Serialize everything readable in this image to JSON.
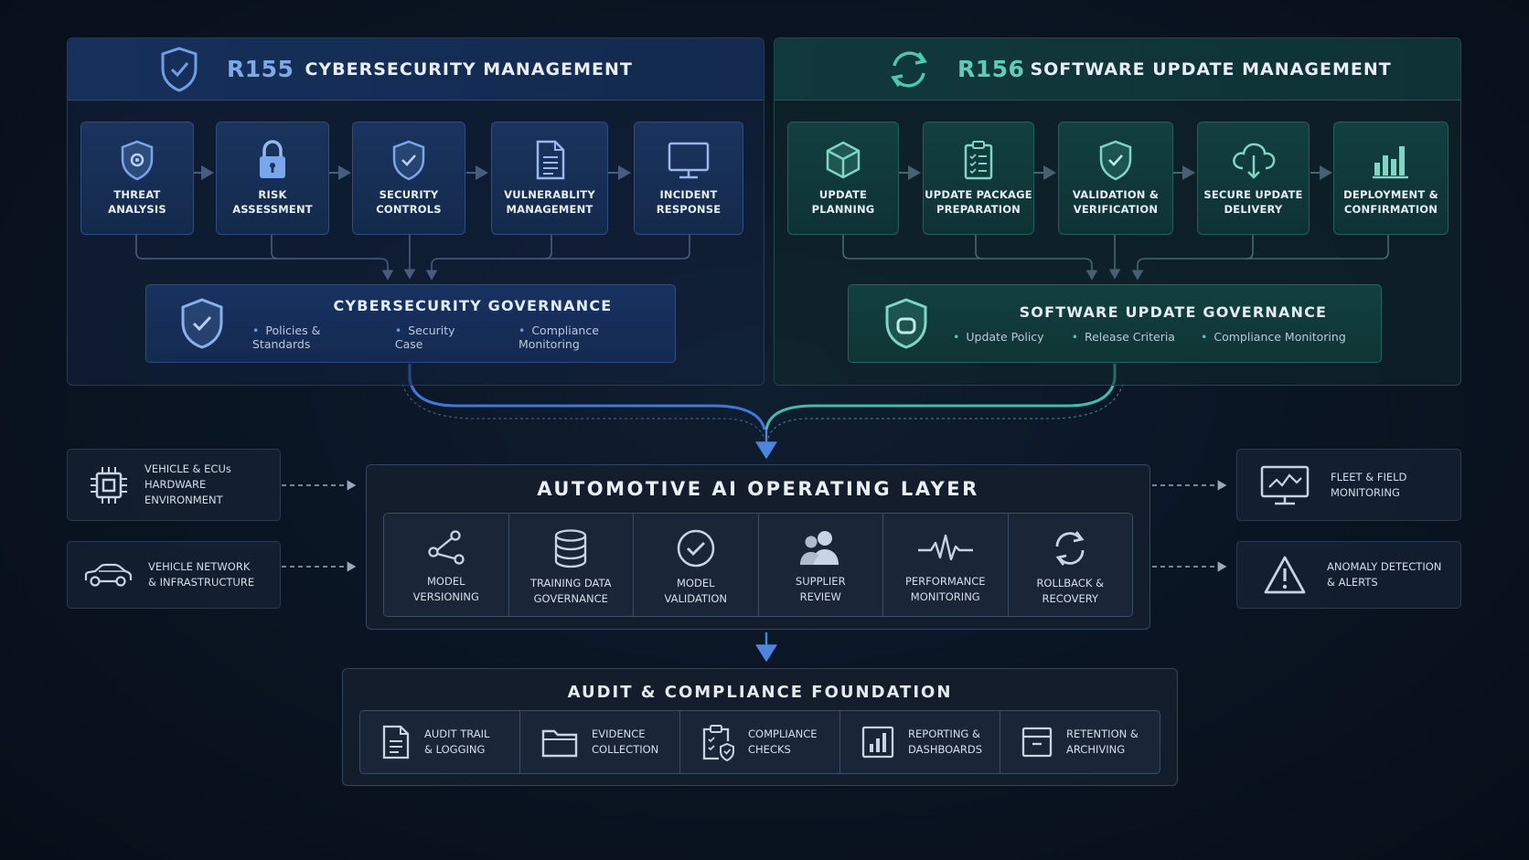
{
  "r155": {
    "code": "R155",
    "title": "CYBERSECURITY MANAGEMENT",
    "steps": [
      {
        "label": "THREAT\nANALYSIS",
        "icon": "shield-target-icon"
      },
      {
        "label": "RISK\nASSESSMENT",
        "icon": "lock-icon"
      },
      {
        "label": "SECURITY\nCONTROLS",
        "icon": "shield-check-icon"
      },
      {
        "label": "VULNERABLITY\nMANAGEMENT",
        "icon": "document-icon"
      },
      {
        "label": "INCIDENT\nRESPONSE",
        "icon": "monitor-icon"
      }
    ],
    "governance": {
      "title": "CYBERSECURITY GOVERNANCE",
      "items": [
        "Policies & Standards",
        "Security Case",
        "Compliance Monitoring"
      ]
    }
  },
  "r156": {
    "code": "R156",
    "title": "SOFTWARE UPDATE MANAGEMENT",
    "steps": [
      {
        "label": "UPDATE\nPLANNING",
        "icon": "cube-icon"
      },
      {
        "label": "UPDATE PACKAGE\nPREPARATION",
        "icon": "clipboard-checklist-icon"
      },
      {
        "label": "VALIDATION &\nVERIFICATION",
        "icon": "shield-check-icon"
      },
      {
        "label": "SECURE UPDATE\nDELIVERY",
        "icon": "cloud-download-icon"
      },
      {
        "label": "DEPLOYMENT &\nCONFIRMATION",
        "icon": "bar-chart-icon"
      }
    ],
    "governance": {
      "title": "SOFTWARE UPDATE GOVERNANCE",
      "items": [
        "Update Policy",
        "Release Criteria",
        "Compliance Monitoring"
      ]
    }
  },
  "inputs": [
    {
      "label": "VEHICLE & ECUs\nHARDWARE ENVIRONMENT",
      "icon": "chip-icon"
    },
    {
      "label": "VEHICLE NETWORK\n& INFRASTRUCTURE",
      "icon": "car-icon"
    }
  ],
  "outputs": [
    {
      "label": "FLEET & FIELD\nMONITORING",
      "icon": "monitor-chart-icon"
    },
    {
      "label": "ANOMALY DETECTION\n& ALERTS",
      "icon": "warning-icon"
    }
  ],
  "ai_layer": {
    "title": "AUTOMOTIVE AI OPERATING LAYER",
    "items": [
      {
        "label": "MODEL\nVERSIONING",
        "icon": "branch-icon"
      },
      {
        "label": "TRAINING DATA\nGOVERNANCE",
        "icon": "database-icon"
      },
      {
        "label": "MODEL\nVALIDATION",
        "icon": "check-circle-icon"
      },
      {
        "label": "SUPPLIER\nREVIEW",
        "icon": "users-icon"
      },
      {
        "label": "PERFORMANCE\nMONITORING",
        "icon": "pulse-icon"
      },
      {
        "label": "ROLLBACK &\nRECOVERY",
        "icon": "refresh-icon"
      }
    ]
  },
  "audit": {
    "title": "AUDIT & COMPLIANCE FOUNDATION",
    "items": [
      {
        "label": "AUDIT TRAIL\n& LOGGING",
        "icon": "document-lines-icon"
      },
      {
        "label": "EVIDENCE\nCOLLECTION",
        "icon": "folder-icon"
      },
      {
        "label": "COMPLIANCE\nCHECKS",
        "icon": "clipboard-shield-icon"
      },
      {
        "label": "REPORTING &\nDASHBOARDS",
        "icon": "report-chart-icon"
      },
      {
        "label": "RETENTION &\nARCHIVING",
        "icon": "archive-icon"
      }
    ]
  },
  "colors": {
    "r155_accent": "#7fa8e6",
    "r156_accent": "#5fcdb6",
    "background": "#0a1422"
  }
}
